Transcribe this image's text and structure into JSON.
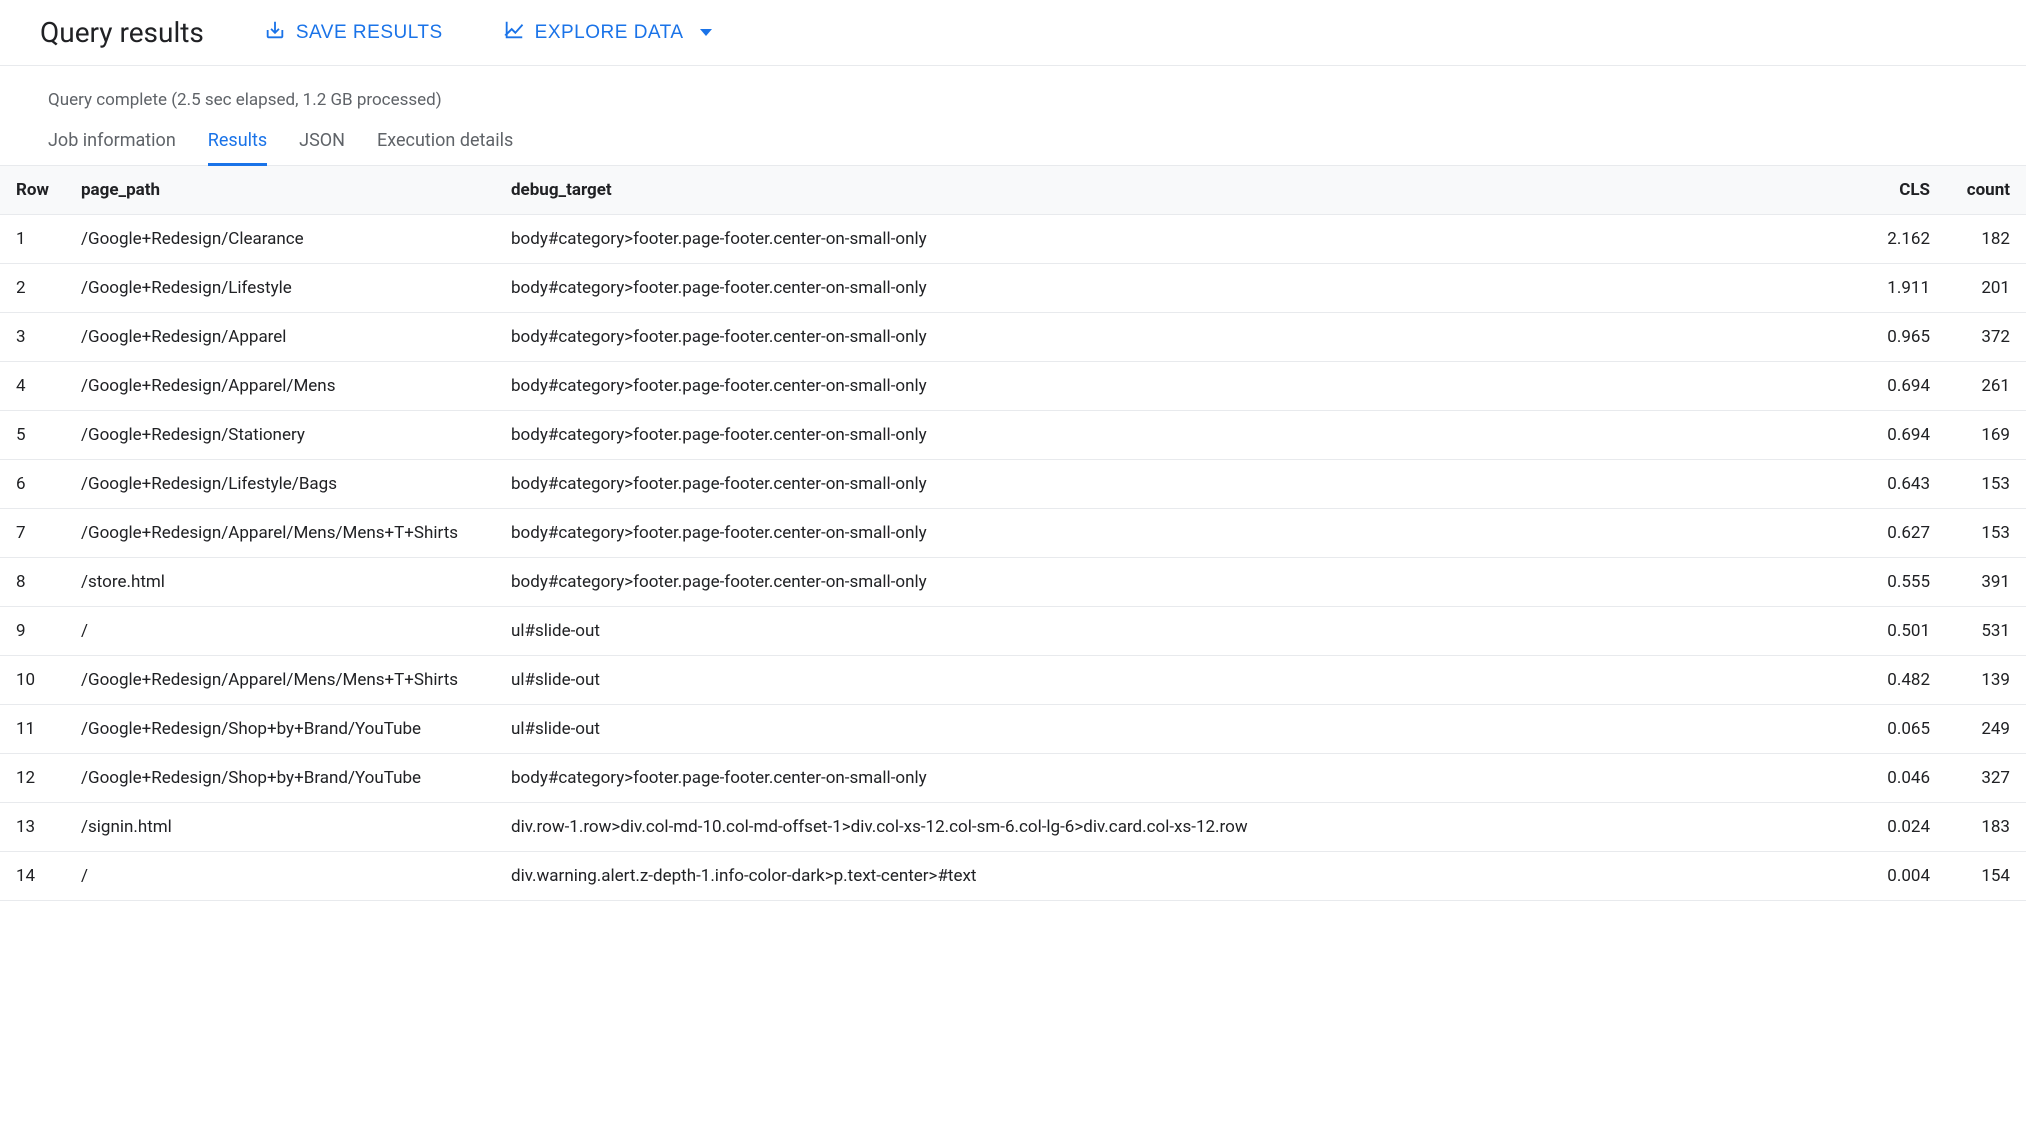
{
  "header": {
    "title": "Query results",
    "save_label": "SAVE RESULTS",
    "explore_label": "EXPLORE DATA"
  },
  "status": "Query complete (2.5 sec elapsed, 1.2 GB processed)",
  "tabs": {
    "job_info": "Job information",
    "results": "Results",
    "json": "JSON",
    "execution": "Execution details"
  },
  "columns": {
    "row": "Row",
    "page_path": "page_path",
    "debug_target": "debug_target",
    "cls": "CLS",
    "count": "count"
  },
  "rows": [
    {
      "row": "1",
      "page_path": "/Google+Redesign/Clearance",
      "debug_target": "body#category>footer.page-footer.center-on-small-only",
      "cls": "2.162",
      "count": "182"
    },
    {
      "row": "2",
      "page_path": "/Google+Redesign/Lifestyle",
      "debug_target": "body#category>footer.page-footer.center-on-small-only",
      "cls": "1.911",
      "count": "201"
    },
    {
      "row": "3",
      "page_path": "/Google+Redesign/Apparel",
      "debug_target": "body#category>footer.page-footer.center-on-small-only",
      "cls": "0.965",
      "count": "372"
    },
    {
      "row": "4",
      "page_path": "/Google+Redesign/Apparel/Mens",
      "debug_target": "body#category>footer.page-footer.center-on-small-only",
      "cls": "0.694",
      "count": "261"
    },
    {
      "row": "5",
      "page_path": "/Google+Redesign/Stationery",
      "debug_target": "body#category>footer.page-footer.center-on-small-only",
      "cls": "0.694",
      "count": "169"
    },
    {
      "row": "6",
      "page_path": "/Google+Redesign/Lifestyle/Bags",
      "debug_target": "body#category>footer.page-footer.center-on-small-only",
      "cls": "0.643",
      "count": "153"
    },
    {
      "row": "7",
      "page_path": "/Google+Redesign/Apparel/Mens/Mens+T+Shirts",
      "debug_target": "body#category>footer.page-footer.center-on-small-only",
      "cls": "0.627",
      "count": "153"
    },
    {
      "row": "8",
      "page_path": "/store.html",
      "debug_target": "body#category>footer.page-footer.center-on-small-only",
      "cls": "0.555",
      "count": "391"
    },
    {
      "row": "9",
      "page_path": "/",
      "debug_target": "ul#slide-out",
      "cls": "0.501",
      "count": "531"
    },
    {
      "row": "10",
      "page_path": "/Google+Redesign/Apparel/Mens/Mens+T+Shirts",
      "debug_target": "ul#slide-out",
      "cls": "0.482",
      "count": "139"
    },
    {
      "row": "11",
      "page_path": "/Google+Redesign/Shop+by+Brand/YouTube",
      "debug_target": "ul#slide-out",
      "cls": "0.065",
      "count": "249"
    },
    {
      "row": "12",
      "page_path": "/Google+Redesign/Shop+by+Brand/YouTube",
      "debug_target": "body#category>footer.page-footer.center-on-small-only",
      "cls": "0.046",
      "count": "327"
    },
    {
      "row": "13",
      "page_path": "/signin.html",
      "debug_target": "div.row-1.row>div.col-md-10.col-md-offset-1>div.col-xs-12.col-sm-6.col-lg-6>div.card.col-xs-12.row",
      "cls": "0.024",
      "count": "183"
    },
    {
      "row": "14",
      "page_path": "/",
      "debug_target": "div.warning.alert.z-depth-1.info-color-dark>p.text-center>#text",
      "cls": "0.004",
      "count": "154"
    }
  ]
}
